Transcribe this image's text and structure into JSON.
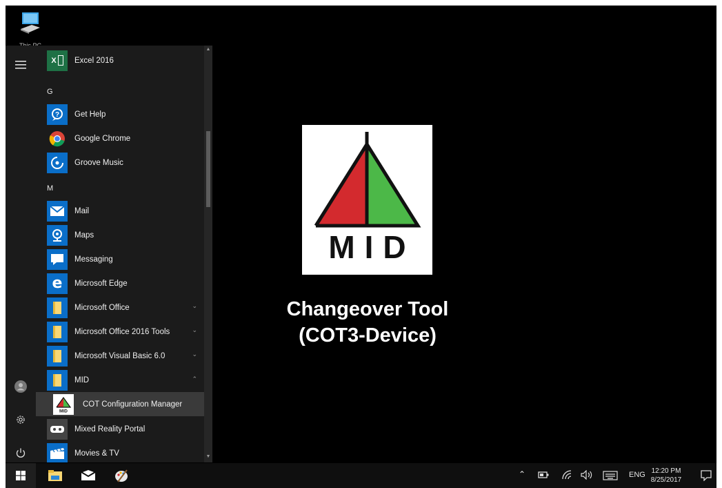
{
  "desktop": {
    "icons": [
      {
        "label": "This PC",
        "icon": "computer-icon"
      }
    ]
  },
  "start_menu": {
    "rail": {
      "expand": "hamburger-icon",
      "account": "user-icon",
      "settings": "gear-icon",
      "power": "power-icon"
    },
    "apps": [
      {
        "label": "Excel 2016",
        "icon": "excel-icon",
        "tile_color": "#1e7145"
      },
      {
        "header": "G"
      },
      {
        "label": "Get Help",
        "icon": "get-help-icon",
        "tile_color": "#0a6ec8"
      },
      {
        "label": "Google Chrome",
        "icon": "chrome-icon",
        "tile_color": ""
      },
      {
        "label": "Groove Music",
        "icon": "groove-music-icon",
        "tile_color": "#0a6ec8"
      },
      {
        "header": "M"
      },
      {
        "label": "Mail",
        "icon": "mail-icon",
        "tile_color": "#0a6ec8"
      },
      {
        "label": "Maps",
        "icon": "maps-icon",
        "tile_color": "#0a6ec8"
      },
      {
        "label": "Messaging",
        "icon": "messaging-icon",
        "tile_color": "#0a6ec8"
      },
      {
        "label": "Microsoft Edge",
        "icon": "edge-icon",
        "tile_color": "#0a6ec8"
      },
      {
        "label": "Microsoft Office",
        "icon": "folder-icon",
        "tile_color": "#0a6ec8",
        "expandable": "collapsed"
      },
      {
        "label": "Microsoft Office 2016 Tools",
        "icon": "folder-icon",
        "tile_color": "#0a6ec8",
        "expandable": "collapsed"
      },
      {
        "label": "Microsoft Visual Basic 6.0",
        "icon": "folder-icon",
        "tile_color": "#0a6ec8",
        "expandable": "collapsed"
      },
      {
        "label": "MID",
        "icon": "folder-icon",
        "tile_color": "#0a6ec8",
        "expandable": "expanded"
      },
      {
        "label": "COT Configuration Manager",
        "icon": "mid-logo-icon",
        "tile_color": "#ffffff",
        "selected": true
      },
      {
        "label": "Mixed Reality Portal",
        "icon": "mixed-reality-icon",
        "tile_color": "#444444"
      },
      {
        "label": "Movies & TV",
        "icon": "movies-tv-icon",
        "tile_color": "#0a6ec8"
      }
    ]
  },
  "wallpaper": {
    "logo_text": "MID",
    "product_line1": "Changeover Tool",
    "product_line2": "(COT3-Device)",
    "colors": {
      "red": "#d32a2e",
      "green": "#4cb848"
    }
  },
  "taskbar": {
    "pinned": [
      "windows-start-icon",
      "file-explorer-icon",
      "mail-icon",
      "paint-icon"
    ],
    "tray": {
      "language": "ENG",
      "time": "12:20 PM",
      "date": "8/25/2017"
    }
  }
}
